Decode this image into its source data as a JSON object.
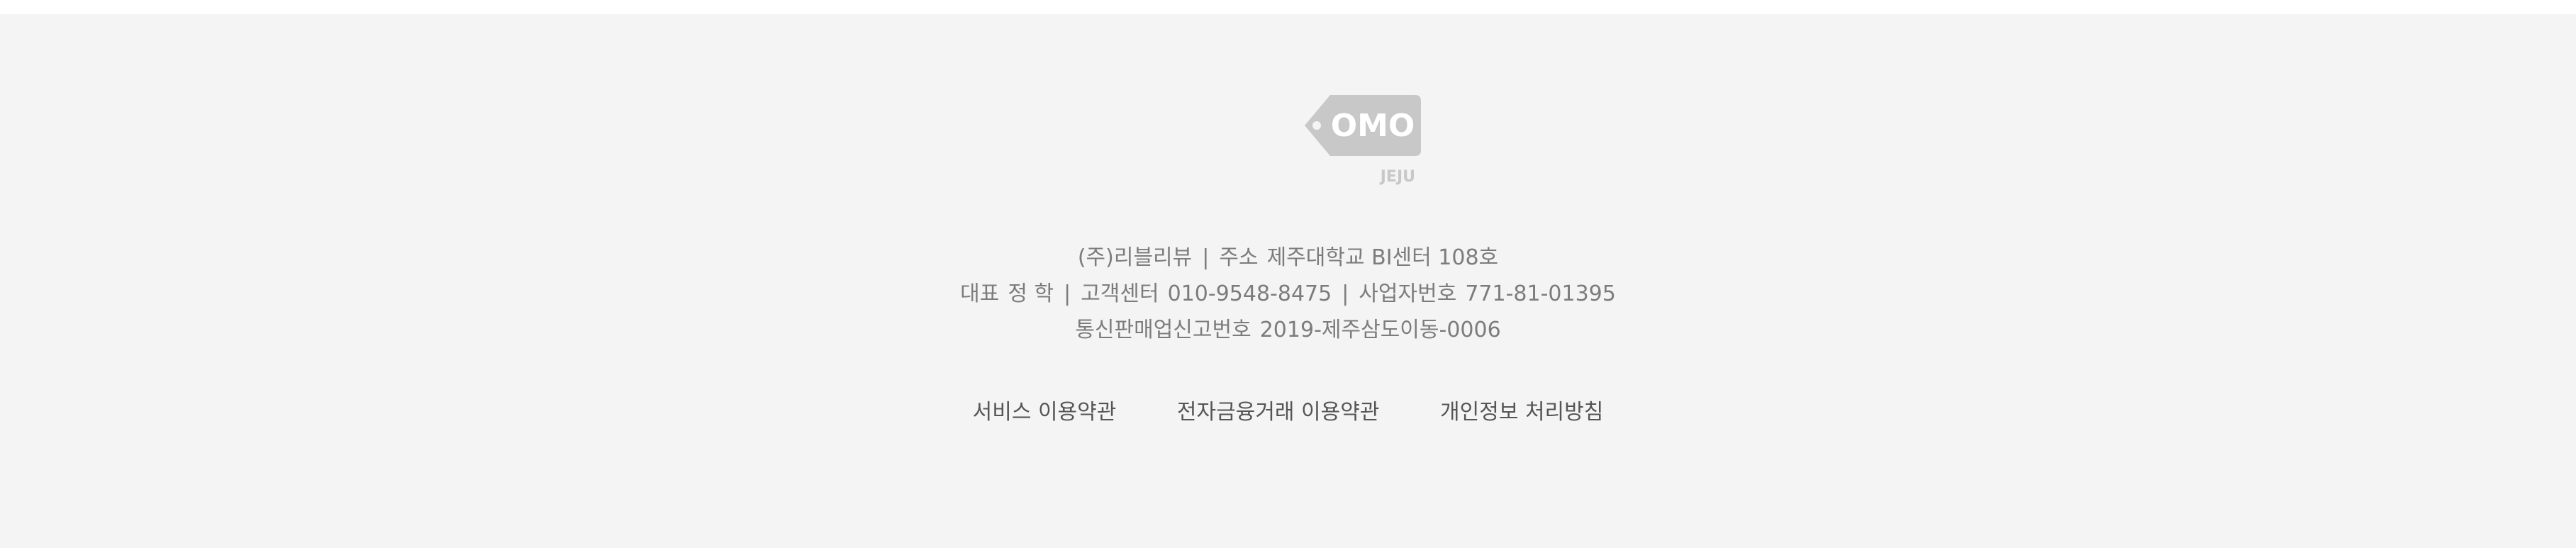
{
  "logo": {
    "main_text": "OMO",
    "sub_text": "JEJU",
    "color": "#c8c8c8"
  },
  "company": {
    "name": "(주)리블리뷰",
    "address_label": "주소",
    "address": "제주대학교 BI센터 108호",
    "ceo_label": "대표",
    "ceo_name": "정 학",
    "cs_label": "고객센터",
    "cs_phone": "010-9548-8475",
    "biz_label": "사업자번호",
    "biz_number": "771-81-01395",
    "mail_order_label": "통신판매업신고번호",
    "mail_order_number": "2019-제주삼도이동-0006"
  },
  "links": {
    "terms": "서비스 이용약관",
    "financial_terms": "전자금융거래 이용약관",
    "privacy": "개인정보 처리방침"
  },
  "colors": {
    "background": "#f4f4f4",
    "info_text": "#7c7c7c",
    "link_text": "#555555"
  }
}
